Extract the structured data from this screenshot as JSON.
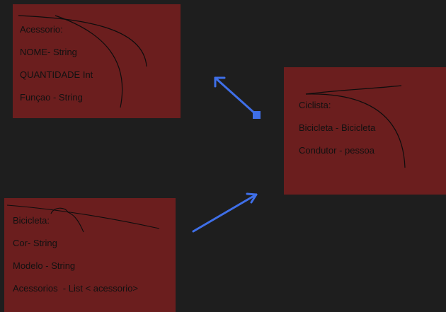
{
  "colors": {
    "background": "#1e1e1e",
    "note_fill": "#6b1e1e",
    "text": "#111111",
    "arrow": "#3f6fe8",
    "sketch_stroke": "#0d0d0d"
  },
  "notes": {
    "acessorio": {
      "title": "Acessorio:",
      "lines": [
        "NOME- String",
        "QUANTIDADE Int",
        "Funçao - String"
      ]
    },
    "ciclista": {
      "title": "Ciclista:",
      "lines": [
        "Bicicleta - Bicicleta",
        "Condutor - pessoa"
      ]
    },
    "bicicleta": {
      "title": "Bicicleta:",
      "lines": [
        "Cor- String",
        "Modelo - String",
        "Acessorios  - List < acessorio>"
      ]
    }
  },
  "connectors": [
    {
      "from": "ciclista",
      "to": "acessorio",
      "style": "square-tail-arrow-head"
    },
    {
      "from": "bicicleta",
      "to": "ciclista",
      "style": "arrow-head"
    }
  ]
}
